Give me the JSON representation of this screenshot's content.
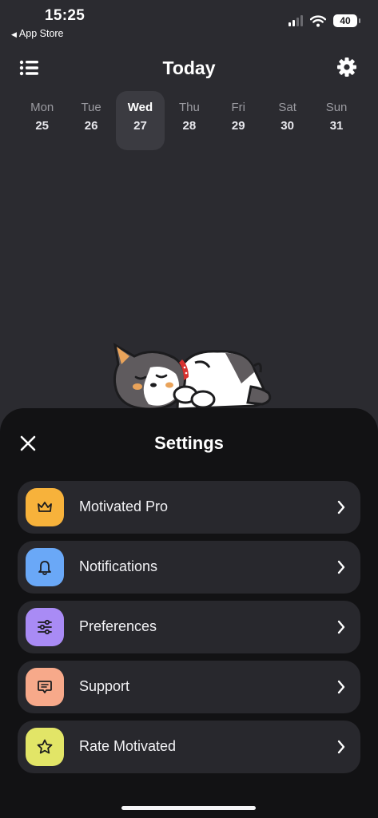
{
  "status_bar": {
    "time": "15:25",
    "back_label": "App Store",
    "battery": "40",
    "icons": [
      "signal-icon",
      "wifi-icon",
      "battery-icon"
    ]
  },
  "header": {
    "title": "Today",
    "left_icon": "list-icon",
    "right_icon": "gear-icon"
  },
  "days": [
    {
      "name": "Mon",
      "date": "25",
      "selected": false
    },
    {
      "name": "Tue",
      "date": "26",
      "selected": false
    },
    {
      "name": "Wed",
      "date": "27",
      "selected": true
    },
    {
      "name": "Thu",
      "date": "28",
      "selected": false
    },
    {
      "name": "Fri",
      "date": "29",
      "selected": false
    },
    {
      "name": "Sat",
      "date": "30",
      "selected": false
    },
    {
      "name": "Sun",
      "date": "31",
      "selected": false
    }
  ],
  "settings": {
    "title": "Settings",
    "close_icon": "close-icon",
    "items": [
      {
        "label": "Motivated Pro",
        "icon": "crown-icon",
        "color": "#f7b23b"
      },
      {
        "label": "Notifications",
        "icon": "bell-icon",
        "color": "#6aa8f7"
      },
      {
        "label": "Preferences",
        "icon": "sliders-icon",
        "color": "#a98bf5"
      },
      {
        "label": "Support",
        "icon": "message-icon",
        "color": "#f7a98a"
      },
      {
        "label": "Rate Motivated",
        "icon": "star-icon",
        "color": "#e2e567"
      }
    ]
  },
  "colors": {
    "background": "#2b2b30",
    "sheet": "#121214",
    "row": "#28282d",
    "selected_day": "#3b3b41"
  }
}
